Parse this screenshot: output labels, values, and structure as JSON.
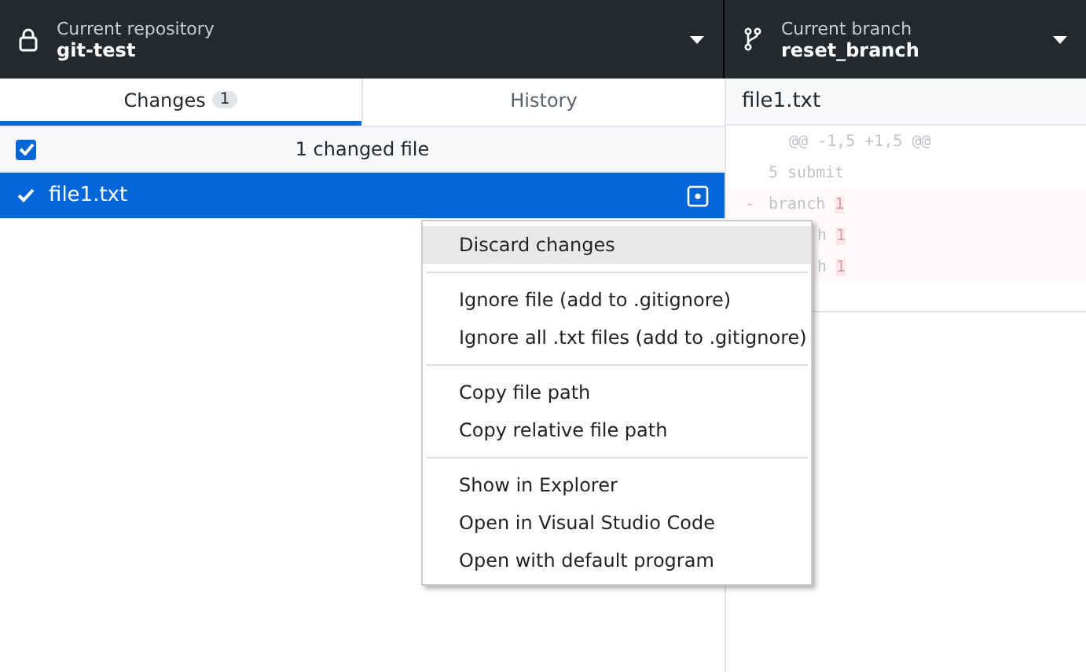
{
  "toolbar": {
    "repository": {
      "label": "Current repository",
      "value": "git-test"
    },
    "branch": {
      "label": "Current branch",
      "value": "reset_branch"
    }
  },
  "tabs": [
    {
      "label": "Changes",
      "count": "1",
      "selected": true
    },
    {
      "label": "History",
      "selected": false
    }
  ],
  "changes": {
    "summary": "1 changed file",
    "all_checked": true,
    "files": [
      {
        "name": "file1.txt",
        "checked": true,
        "selected": true
      }
    ]
  },
  "diff": {
    "file": "file1.txt",
    "hunk": "@@ -1,5 +1,5 @@",
    "lines": [
      {
        "kind": "context",
        "text": "5 submit"
      },
      {
        "kind": "deleted",
        "marker": "-",
        "text": "branch ",
        "mark": "1"
      },
      {
        "kind": "deleted_hidden",
        "text": "h ",
        "mark": "1"
      },
      {
        "kind": "deleted_hidden",
        "text": "h ",
        "mark": "1"
      }
    ]
  },
  "context_menu": [
    [
      {
        "label": "Discard changes",
        "hovered": true
      }
    ],
    [
      {
        "label": "Ignore file (add to .gitignore)",
        "hovered": false
      },
      {
        "label": "Ignore all .txt files (add to .gitignore)",
        "hovered": false
      }
    ],
    [
      {
        "label": "Copy file path",
        "hovered": false
      },
      {
        "label": "Copy relative file path",
        "hovered": false
      }
    ],
    [
      {
        "label": "Show in Explorer",
        "hovered": false
      },
      {
        "label": "Open in Visual Studio Code",
        "hovered": false
      },
      {
        "label": "Open with default program",
        "hovered": false
      }
    ]
  ]
}
